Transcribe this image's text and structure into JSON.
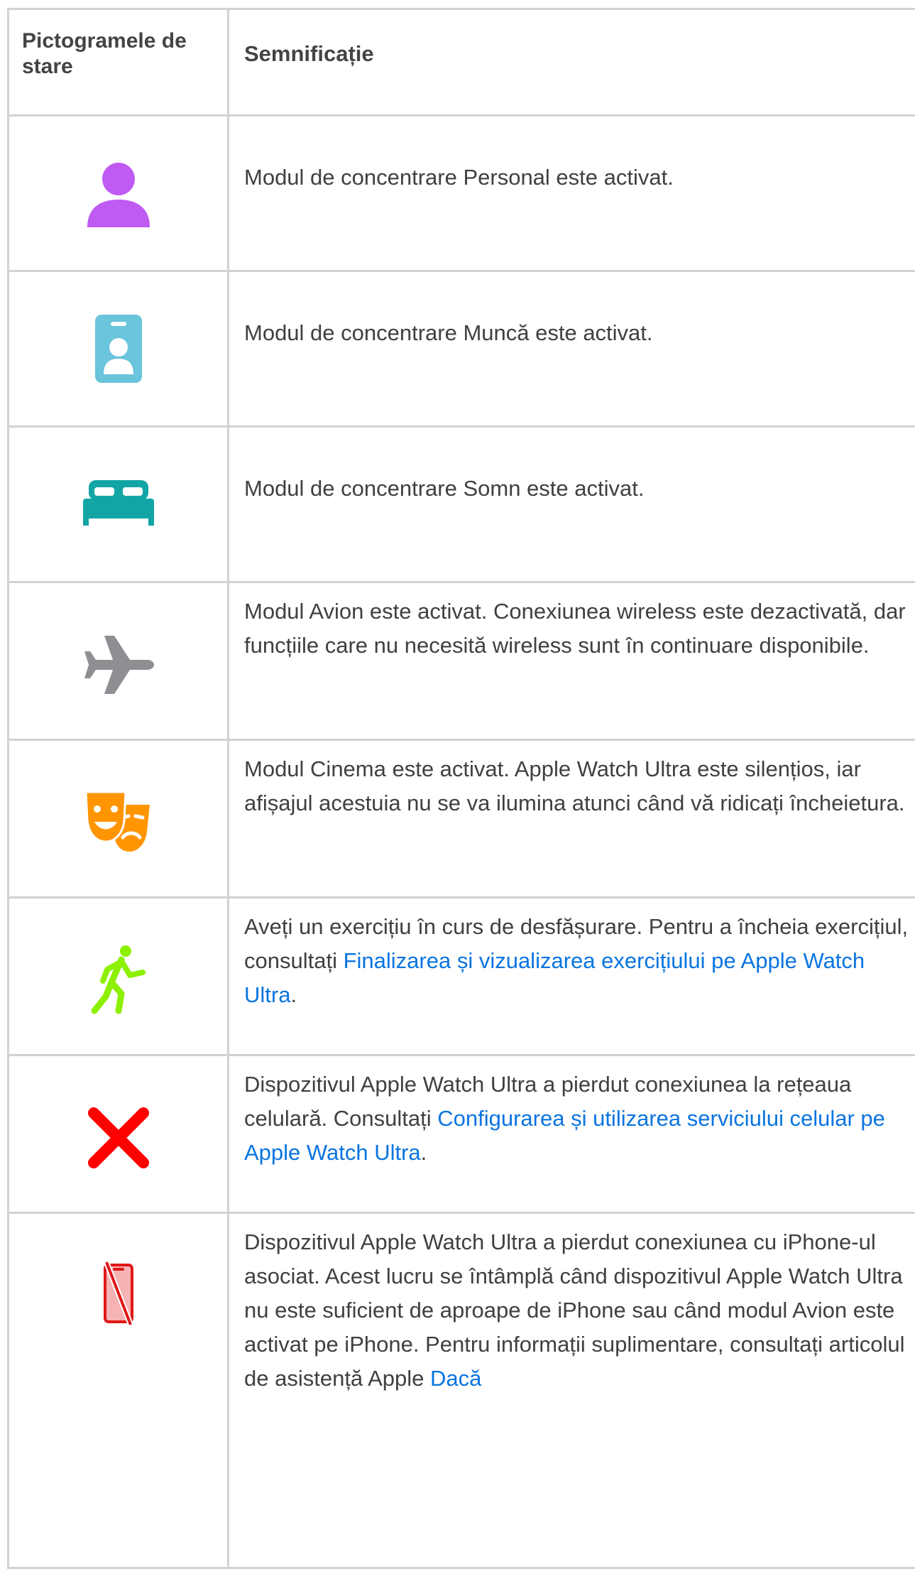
{
  "table": {
    "headers": [
      "Pictogramele de stare",
      "Semnificație"
    ],
    "rows": [
      {
        "icon": "person-focus-icon",
        "text": "Modul de concentrare Personal este activat."
      },
      {
        "icon": "work-badge-icon",
        "text": "Modul de concentrare Muncă este activat."
      },
      {
        "icon": "bed-icon",
        "text": "Modul de concentrare Somn este activat."
      },
      {
        "icon": "airplane-icon",
        "text": "Modul Avion este activat. Conexiunea wireless este dezactivată, dar funcțiile care nu necesită wireless sunt în continuare disponibile."
      },
      {
        "icon": "theater-masks-icon",
        "text": "Modul Cinema este activat. Apple Watch Ultra este silențios, iar afișajul acestuia nu se va ilumina atunci când vă ridicați încheietura."
      },
      {
        "icon": "running-figure-icon",
        "text": "Aveți un exercițiu în curs de desfășurare. Pentru a încheia exercițiul, consultați ",
        "link": "Finalizarea și vizualizarea exercițiului pe Apple Watch Ultra",
        "after": "."
      },
      {
        "icon": "red-x-icon",
        "text": "Dispozitivul Apple Watch Ultra a pierdut conexiunea la rețeaua celulară. Consultați ",
        "link": "Configurarea și utilizarea serviciului celular pe Apple Watch Ultra",
        "after": "."
      },
      {
        "icon": "disconnected-iphone-icon",
        "text": "Dispozitivul Apple Watch Ultra a pierdut conexiunea cu iPhone-ul asociat. Acest lucru se întâmplă când dispozitivul Apple Watch Ultra nu este suficient de aproape de iPhone sau când modul Avion este activat pe iPhone. Pentru informații suplimentare, consultați articolul de asistență Apple ",
        "link": "Dacă"
      }
    ]
  },
  "colors": {
    "person": "#bf5af2",
    "work": "#6ac4dc",
    "bed": "#13a5a5",
    "airplane": "#8e8e93",
    "theater": "#ff9500",
    "run": "#8cf000",
    "x": "#ff0000",
    "link": "#0a74e0"
  }
}
